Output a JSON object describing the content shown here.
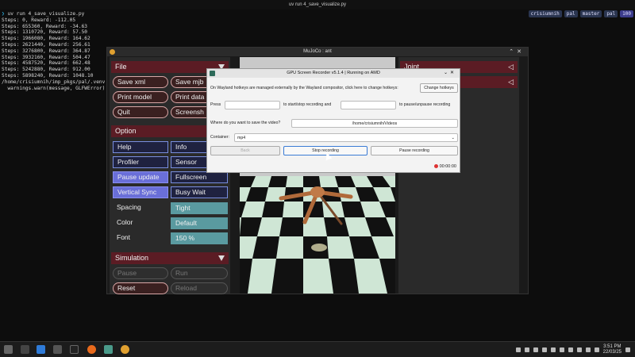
{
  "terminal": {
    "title": "uv run 4_save_visualize.py",
    "command_prompt": "❯",
    "command": "uv run 4_save_visualize.py",
    "lines": [
      "Steps: 0, Reward: -112.05",
      "Steps: 655360, Reward: -34.63",
      "Steps: 1310720, Reward: 57.50",
      "Steps: 1966080, Reward: 164.62",
      "Steps: 2621440, Reward: 256.61",
      "Steps: 3276800, Reward: 364.87",
      "Steps: 3932160, Reward: 504.47",
      "Steps: 4587520, Reward: 662.48",
      "Steps: 5242880, Reward: 912.00",
      "Steps: 5898240, Reward: 1048.10",
      "/home/crisiumnih/imp_pkgs/pal/.venv",
      "  warnings.warn(message, GLFWError)"
    ],
    "tags": [
      "crisiumnih",
      "pal",
      "master",
      "pal",
      "100"
    ]
  },
  "mujoco": {
    "title": "MuJoCo : ant",
    "file_section": "File",
    "file_buttons": [
      "Save xml",
      "Save mjb",
      "Print model",
      "Print data",
      "Quit",
      "Screensh"
    ],
    "option_section": "Option",
    "option_buttons": [
      "Help",
      "Info",
      "Profiler",
      "Sensor",
      "Pause update",
      "Fullscreen",
      "Vertical Sync",
      "Busy Wait"
    ],
    "spacing_label": "Spacing",
    "spacing_value": "Tight",
    "color_label": "Color",
    "color_value": "Default",
    "font_label": "Font",
    "font_value": "150 %",
    "simulation_section": "Simulation",
    "sim_buttons": [
      "Pause",
      "Run",
      "Reset",
      "Reload"
    ],
    "right_sections": [
      "Joint",
      ""
    ]
  },
  "recorder": {
    "title": "GPU Screen Recorder v5.1.4 | Running on AMD",
    "hotkeys_info": "On Wayland hotkeys are managed externally by the Wayland compositor, click here to change hotkeys:",
    "change_hotkeys": "Change hotkeys",
    "press_label": "Press",
    "start_stop_label": "to start/stop recording and",
    "pause_label": "to pause/unpause recording",
    "save_question": "Where do you want to save the video?",
    "save_path": "/home/crisiumnih/Videos",
    "container_label": "Container:",
    "container_value": "mp4",
    "back_button": "Back",
    "stop_button": "Stop recording",
    "pause_button": "Pause recording",
    "timer": "00:00:00"
  },
  "taskbar": {
    "time": "3:51 PM",
    "date": "22/03/25"
  }
}
